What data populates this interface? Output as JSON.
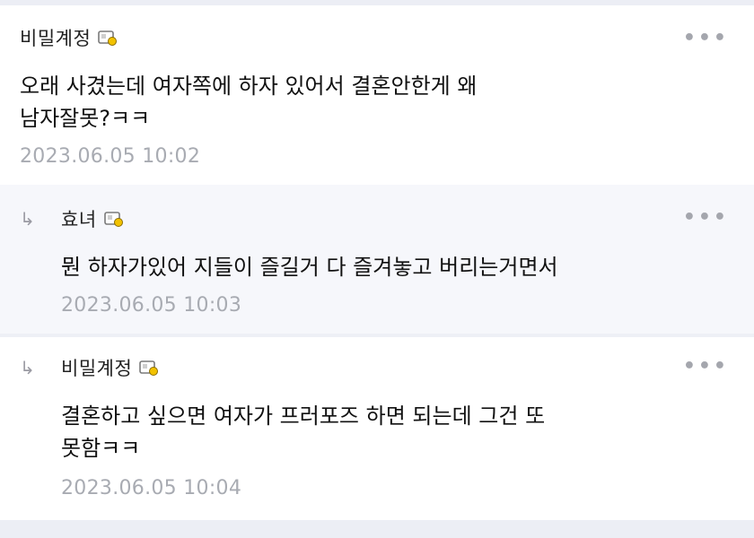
{
  "comments": [
    {
      "author": "비밀계정",
      "text": "오래 사겼는데 여자쪽에 하자 있어서 결혼안한게 왜\n남자잘못?ㅋㅋ",
      "timestamp": "2023.06.05 10:02",
      "is_reply": false
    },
    {
      "author": "효녀",
      "text": "뭔 하자가있어 지들이 즐길거 다 즐겨놓고 버리는거면서",
      "timestamp": "2023.06.05 10:03",
      "is_reply": true
    },
    {
      "author": "비밀계정",
      "text": "결혼하고 싶으면 여자가 프러포즈 하면 되는데 그건 또\n못함ㅋㅋ",
      "timestamp": "2023.06.05 10:04",
      "is_reply": true
    }
  ],
  "icons": {
    "more": "•••",
    "reply": "↳",
    "badge": "user-badge-icon"
  },
  "colors": {
    "reply_bg": "#f6f7fb",
    "timestamp": "#a8abb2",
    "badge_yellow": "#f2c200"
  }
}
